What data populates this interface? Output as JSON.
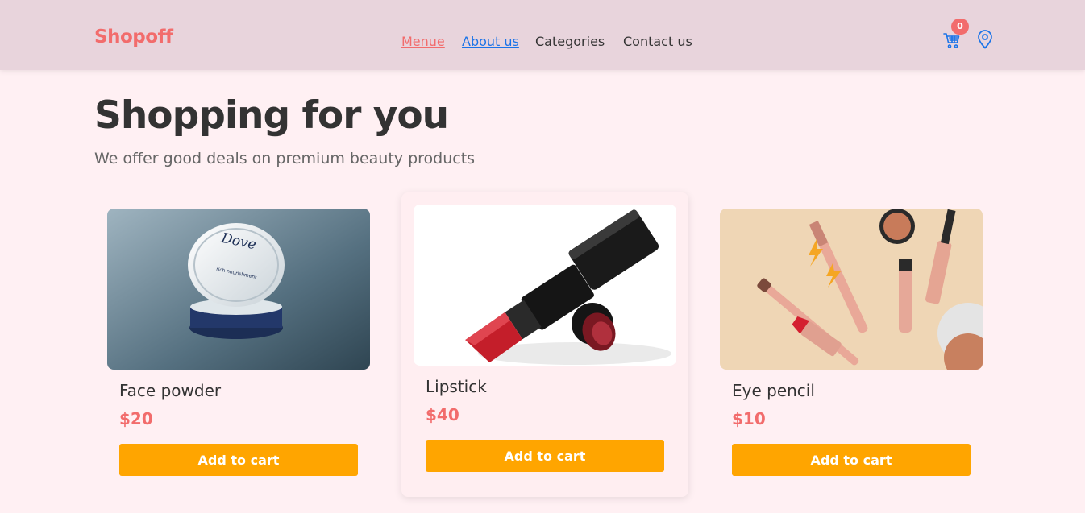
{
  "brand": {
    "name": "Shopoff",
    "color": "#f26c6c"
  },
  "nav": {
    "items": [
      "Menue",
      "About us",
      "Categories",
      "Contact us"
    ]
  },
  "header": {
    "cart_count": "0",
    "cart_icon": "cart-icon",
    "location_icon": "location-pin-icon"
  },
  "hero": {
    "title": "Shopping for you",
    "subtitle": "We offer good deals on premium beauty products"
  },
  "products": [
    {
      "name": "Face powder",
      "price": "$20",
      "button": "Add to cart",
      "image": "dove-cream-jar"
    },
    {
      "name": "Lipstick",
      "price": "$40",
      "button": "Add to cart",
      "image": "red-lipsticks"
    },
    {
      "name": "Eye pencil",
      "price": "$10",
      "button": "Add to cart",
      "image": "makeup-flatlay"
    }
  ],
  "colors": {
    "header_bg": "#e8d4dc",
    "page_bg": "#fff0f3",
    "button": "#ffa500",
    "price": "#f26c6c",
    "link_active": "#1a73e8"
  }
}
